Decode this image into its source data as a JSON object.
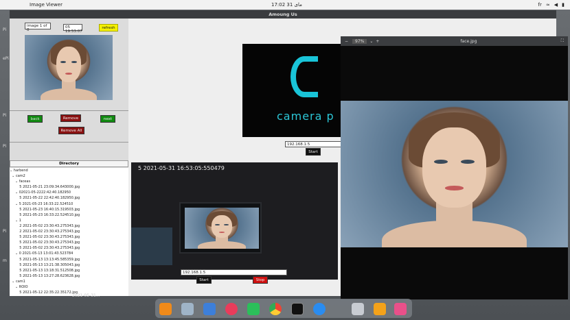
{
  "topbar": {
    "app_name": "Image Viewer",
    "clock": "17:02  31 مای",
    "lang": "fr"
  },
  "main_window": {
    "title": "Amoung Us"
  },
  "left_panel": {
    "image_counter": "image 1 of 0",
    "time_field": "05 19:53:07",
    "refresh_label": "refresh",
    "back_label": "back",
    "remove_label": "Remove",
    "next_label": "next",
    "remove_all_label": "Remove All"
  },
  "directory": {
    "header": "Directory",
    "rows": [
      "⌄ harbend",
      "  ⌄ cam2",
      "     ⌄ faceas",
      "         5 2021-05-21 23:09:34.643000.jpg",
      "     ⌄ 02021-05-2222:42:40.182950",
      "         5 2021-05-22 22:42:40.182950.jpg",
      "     ⌄ 5 2021-05-23 16:33:22.524510",
      "         5 2021-05-23 16:40:15.319503.jpg",
      "         5 2021-05-23 16:33:22.524510.jpg",
      "     ⌄ 1",
      "         2 2021-05-02 23:30:43.275343.jpg",
      "         2 2021-05-02 23:30:43.275343.jpg",
      "         5 2021-05-02 23:30:43.275343.jpg",
      "         5 2021-05-02 23:30:43.275343.jpg",
      "         5 2021-05-02 23:30:43.275343.jpg",
      "     ⌄ 0 2021-05-13 13:01:43.523784",
      "         5 2021-05-13 13:13:45.585359.jpg",
      "         5 2021-05-13 13:21:38.305043.jpg",
      "         5 2021-05-13 13:18:31.512508.jpg",
      "         5 2021-05-13 13:27:28.623628.jpg",
      "  ⌄ cam1",
      "     ⌄ ROIO",
      "         5 2021-05-12 22:35:22.35172.jpg"
    ]
  },
  "camera_panel": {
    "logo_text": "camera p",
    "ip_value": "192.168.1.5",
    "start_label": "Start"
  },
  "stream_panel": {
    "overlay": "5 2021-05-31 16:53:05:550479",
    "ip_value": "192.168.1.5",
    "start_label": "Start",
    "stop_label": "Stop"
  },
  "face_window": {
    "title": "face.jpg",
    "zoom": "97%"
  },
  "desktop": {
    "side_labels": [
      "Pi",
      "ePi",
      "Pi",
      "Pi",
      "Pi",
      "m"
    ],
    "ghost_text": "2021-05-31..."
  },
  "dock": {
    "apps": [
      "firefox-icon",
      "text-editor-icon",
      "finder-icon",
      "music-icon",
      "pycharm-icon",
      "chrome-icon",
      "terminal-icon",
      "app-store-icon",
      "image-viewer-icon",
      "notes-icon",
      "launcher-icon"
    ]
  }
}
